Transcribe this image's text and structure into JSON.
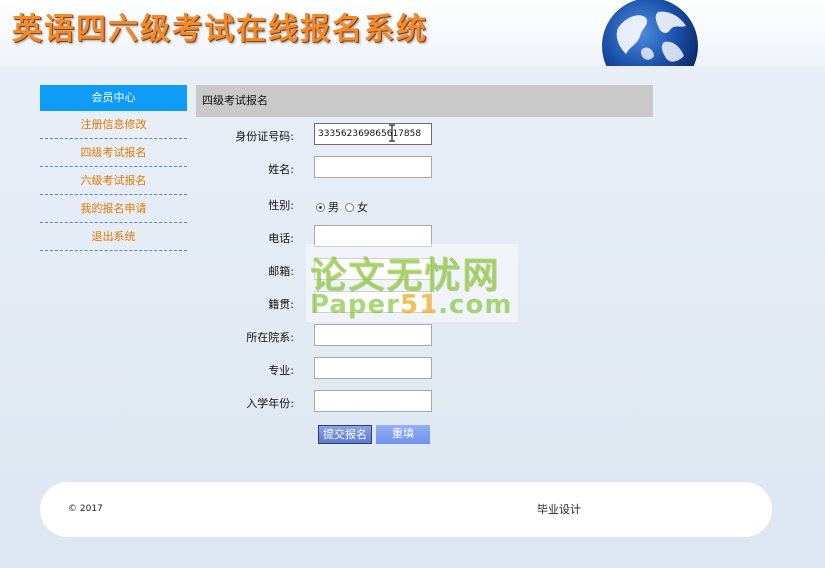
{
  "header": {
    "site_title": "英语四六级考试在线报名系统"
  },
  "sidebar": {
    "heading": "会员中心",
    "items": [
      {
        "label": "注册信息修改"
      },
      {
        "label": "四级考试报名"
      },
      {
        "label": "六级考试报名"
      },
      {
        "label": "我的报名申请"
      },
      {
        "label": "退出系统"
      }
    ]
  },
  "main": {
    "panel_title": "四级考试报名",
    "form": {
      "id_number": {
        "label": "身份证号码:",
        "value": "333562369865617858"
      },
      "name": {
        "label": "姓名:",
        "value": ""
      },
      "gender": {
        "label": "性别:",
        "options": [
          "男",
          "女"
        ],
        "selected": "男"
      },
      "phone": {
        "label": "电话:",
        "value": ""
      },
      "email": {
        "label": "邮箱:",
        "value": ""
      },
      "hometown": {
        "label": "籍贯:",
        "value": ""
      },
      "department": {
        "label": "所在院系:",
        "value": ""
      },
      "major": {
        "label": "专业:",
        "value": ""
      },
      "enroll_year": {
        "label": "入学年份:",
        "value": ""
      }
    },
    "submit_label": "提交报名",
    "reset_label": "重填"
  },
  "watermark": {
    "line1": "论文无忧网",
    "line2_prefix": "Paper",
    "line2_highlight": "51",
    "line2_suffix": ".com"
  },
  "footer": {
    "copyright": "© 2017",
    "note": "毕业设计"
  },
  "colors": {
    "sidebar_head": "#0f9cf6",
    "sidebar_link": "#e07a00",
    "panel_head": "#c9c9c9",
    "title_orange": "#ef8a2e"
  }
}
